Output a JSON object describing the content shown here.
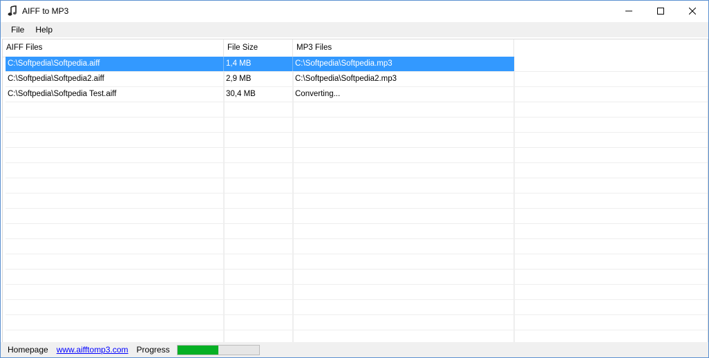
{
  "window": {
    "title": "AIFF to MP3",
    "icon": "music-note-icon"
  },
  "menu": {
    "items": [
      {
        "label": "File"
      },
      {
        "label": "Help"
      }
    ]
  },
  "table": {
    "columns": [
      "AIFF Files",
      "File Size",
      "MP3 Files"
    ],
    "rows": [
      {
        "aiff": "C:\\Softpedia\\Softpedia.aiff",
        "size": "1,4 MB",
        "mp3": "C:\\Softpedia\\Softpedia.mp3",
        "selected": true
      },
      {
        "aiff": "C:\\Softpedia\\Softpedia2.aiff",
        "size": "2,9 MB",
        "mp3": "C:\\Softpedia\\Softpedia2.mp3",
        "selected": false
      },
      {
        "aiff": "C:\\Softpedia\\Softpedia Test.aiff",
        "size": "30,4 MB",
        "mp3": "Converting...",
        "selected": false
      }
    ]
  },
  "statusbar": {
    "homepage_label": "Homepage",
    "homepage_link": "www.aifftomp3.com",
    "progress_label": "Progress",
    "progress_value": 0.5
  },
  "colors": {
    "selection": "#3399ff",
    "progress": "#06b025",
    "link": "#0000ff"
  }
}
